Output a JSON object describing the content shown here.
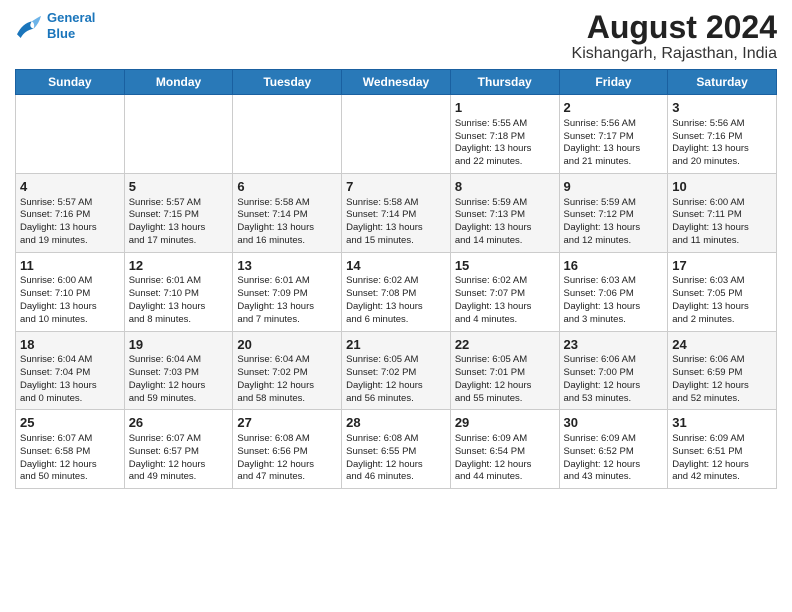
{
  "header": {
    "logo_line1": "General",
    "logo_line2": "Blue",
    "title": "August 2024",
    "subtitle": "Kishangarh, Rajasthan, India"
  },
  "days_of_week": [
    "Sunday",
    "Monday",
    "Tuesday",
    "Wednesday",
    "Thursday",
    "Friday",
    "Saturday"
  ],
  "weeks": [
    [
      {
        "day": "",
        "info": ""
      },
      {
        "day": "",
        "info": ""
      },
      {
        "day": "",
        "info": ""
      },
      {
        "day": "",
        "info": ""
      },
      {
        "day": "1",
        "info": "Sunrise: 5:55 AM\nSunset: 7:18 PM\nDaylight: 13 hours\nand 22 minutes."
      },
      {
        "day": "2",
        "info": "Sunrise: 5:56 AM\nSunset: 7:17 PM\nDaylight: 13 hours\nand 21 minutes."
      },
      {
        "day": "3",
        "info": "Sunrise: 5:56 AM\nSunset: 7:16 PM\nDaylight: 13 hours\nand 20 minutes."
      }
    ],
    [
      {
        "day": "4",
        "info": "Sunrise: 5:57 AM\nSunset: 7:16 PM\nDaylight: 13 hours\nand 19 minutes."
      },
      {
        "day": "5",
        "info": "Sunrise: 5:57 AM\nSunset: 7:15 PM\nDaylight: 13 hours\nand 17 minutes."
      },
      {
        "day": "6",
        "info": "Sunrise: 5:58 AM\nSunset: 7:14 PM\nDaylight: 13 hours\nand 16 minutes."
      },
      {
        "day": "7",
        "info": "Sunrise: 5:58 AM\nSunset: 7:14 PM\nDaylight: 13 hours\nand 15 minutes."
      },
      {
        "day": "8",
        "info": "Sunrise: 5:59 AM\nSunset: 7:13 PM\nDaylight: 13 hours\nand 14 minutes."
      },
      {
        "day": "9",
        "info": "Sunrise: 5:59 AM\nSunset: 7:12 PM\nDaylight: 13 hours\nand 12 minutes."
      },
      {
        "day": "10",
        "info": "Sunrise: 6:00 AM\nSunset: 7:11 PM\nDaylight: 13 hours\nand 11 minutes."
      }
    ],
    [
      {
        "day": "11",
        "info": "Sunrise: 6:00 AM\nSunset: 7:10 PM\nDaylight: 13 hours\nand 10 minutes."
      },
      {
        "day": "12",
        "info": "Sunrise: 6:01 AM\nSunset: 7:10 PM\nDaylight: 13 hours\nand 8 minutes."
      },
      {
        "day": "13",
        "info": "Sunrise: 6:01 AM\nSunset: 7:09 PM\nDaylight: 13 hours\nand 7 minutes."
      },
      {
        "day": "14",
        "info": "Sunrise: 6:02 AM\nSunset: 7:08 PM\nDaylight: 13 hours\nand 6 minutes."
      },
      {
        "day": "15",
        "info": "Sunrise: 6:02 AM\nSunset: 7:07 PM\nDaylight: 13 hours\nand 4 minutes."
      },
      {
        "day": "16",
        "info": "Sunrise: 6:03 AM\nSunset: 7:06 PM\nDaylight: 13 hours\nand 3 minutes."
      },
      {
        "day": "17",
        "info": "Sunrise: 6:03 AM\nSunset: 7:05 PM\nDaylight: 13 hours\nand 2 minutes."
      }
    ],
    [
      {
        "day": "18",
        "info": "Sunrise: 6:04 AM\nSunset: 7:04 PM\nDaylight: 13 hours\nand 0 minutes."
      },
      {
        "day": "19",
        "info": "Sunrise: 6:04 AM\nSunset: 7:03 PM\nDaylight: 12 hours\nand 59 minutes."
      },
      {
        "day": "20",
        "info": "Sunrise: 6:04 AM\nSunset: 7:02 PM\nDaylight: 12 hours\nand 58 minutes."
      },
      {
        "day": "21",
        "info": "Sunrise: 6:05 AM\nSunset: 7:02 PM\nDaylight: 12 hours\nand 56 minutes."
      },
      {
        "day": "22",
        "info": "Sunrise: 6:05 AM\nSunset: 7:01 PM\nDaylight: 12 hours\nand 55 minutes."
      },
      {
        "day": "23",
        "info": "Sunrise: 6:06 AM\nSunset: 7:00 PM\nDaylight: 12 hours\nand 53 minutes."
      },
      {
        "day": "24",
        "info": "Sunrise: 6:06 AM\nSunset: 6:59 PM\nDaylight: 12 hours\nand 52 minutes."
      }
    ],
    [
      {
        "day": "25",
        "info": "Sunrise: 6:07 AM\nSunset: 6:58 PM\nDaylight: 12 hours\nand 50 minutes."
      },
      {
        "day": "26",
        "info": "Sunrise: 6:07 AM\nSunset: 6:57 PM\nDaylight: 12 hours\nand 49 minutes."
      },
      {
        "day": "27",
        "info": "Sunrise: 6:08 AM\nSunset: 6:56 PM\nDaylight: 12 hours\nand 47 minutes."
      },
      {
        "day": "28",
        "info": "Sunrise: 6:08 AM\nSunset: 6:55 PM\nDaylight: 12 hours\nand 46 minutes."
      },
      {
        "day": "29",
        "info": "Sunrise: 6:09 AM\nSunset: 6:54 PM\nDaylight: 12 hours\nand 44 minutes."
      },
      {
        "day": "30",
        "info": "Sunrise: 6:09 AM\nSunset: 6:52 PM\nDaylight: 12 hours\nand 43 minutes."
      },
      {
        "day": "31",
        "info": "Sunrise: 6:09 AM\nSunset: 6:51 PM\nDaylight: 12 hours\nand 42 minutes."
      }
    ]
  ]
}
